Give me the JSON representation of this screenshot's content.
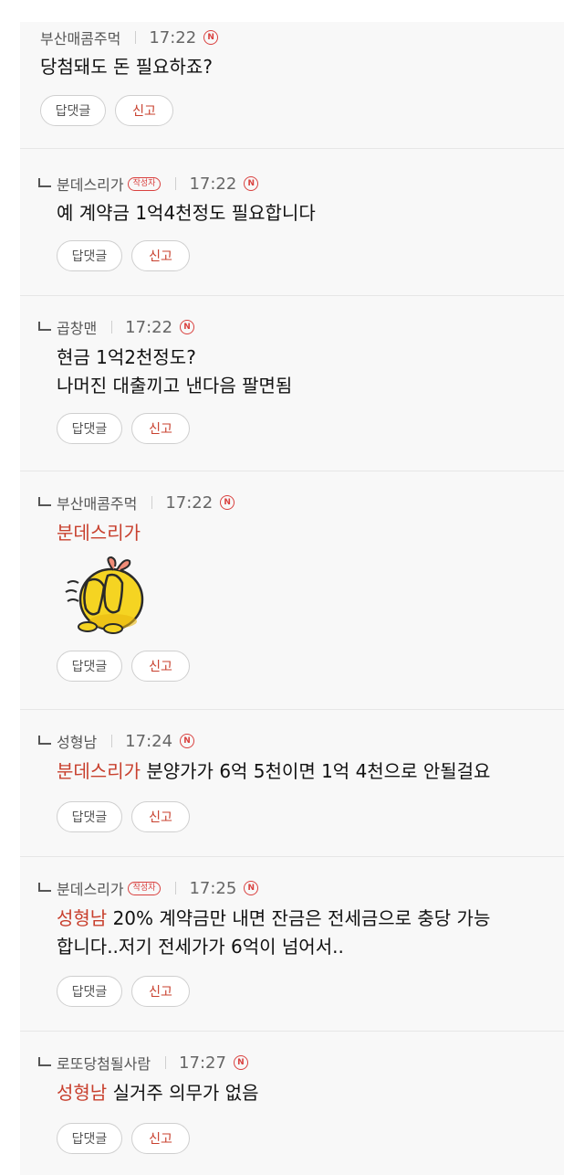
{
  "buttons": {
    "reply": "답댓글",
    "report": "신고"
  },
  "badges": {
    "new": "N",
    "writer": "작성자"
  },
  "comments": [
    {
      "author": "부산매콤주먹",
      "time": "17:22",
      "text": "당첨돼도 돈 필요하죠?"
    },
    {
      "author": "분데스리가",
      "time": "17:22",
      "text": "예 계약금 1억4천정도 필요합니다"
    },
    {
      "author": "곱창맨",
      "time": "17:22",
      "line1": "현금 1억2천정도?",
      "line2": "나머진 대출끼고 낸다음 팔면됨"
    },
    {
      "author": "부산매콤주먹",
      "time": "17:22",
      "mention": "분데스리가",
      "emoticon": "duck-covering-face-emoticon"
    },
    {
      "author": "성형남",
      "time": "17:24",
      "mention": "분데스리가",
      "text": "분양가가 6억 5천이면 1억 4천으로 안될걸요"
    },
    {
      "author": "분데스리가",
      "time": "17:25",
      "mention": "성형남",
      "text": "20% 계약금만 내면 잔금은 전세금으로 충당 가능",
      "line2": "합니다..저기 전세가가 6억이 넘어서.."
    },
    {
      "author": "로또당첨될사람",
      "time": "17:27",
      "mention": "성형남",
      "text": "실거주 의무가 없음"
    }
  ],
  "colors": {
    "accent": "#c8402e",
    "badge": "#d9413f",
    "background": "#f8f8f8"
  }
}
